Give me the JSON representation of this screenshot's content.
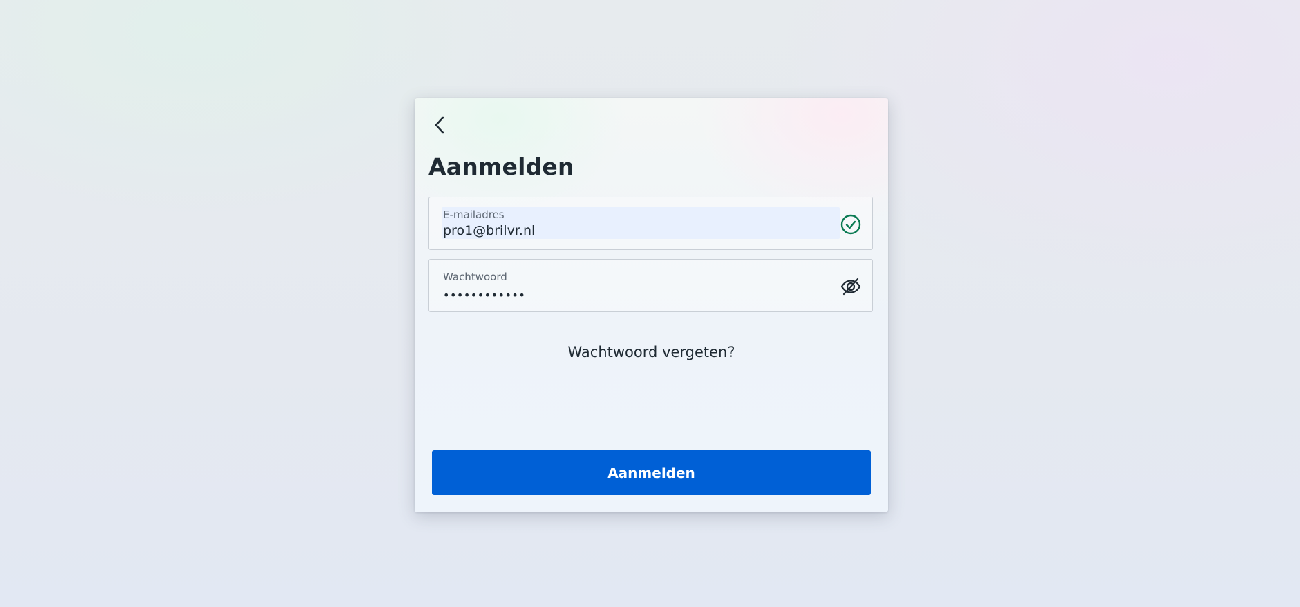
{
  "login": {
    "title": "Aanmelden",
    "email": {
      "label": "E-mailadres",
      "value": "pro1@brilvr.nl",
      "status_icon": "check-circle-icon"
    },
    "password": {
      "label": "Wachtwoord",
      "value": "••••••••••••",
      "toggle_icon": "eye-slash-icon"
    },
    "forgot_link": "Wachtwoord vergeten?",
    "submit_label": "Aanmelden",
    "back_icon": "chevron-left-icon"
  },
  "colors": {
    "primary": "#0060d6",
    "success": "#0a7a52",
    "text": "#1f2a33",
    "autofill_bg": "#e8f0fe"
  }
}
